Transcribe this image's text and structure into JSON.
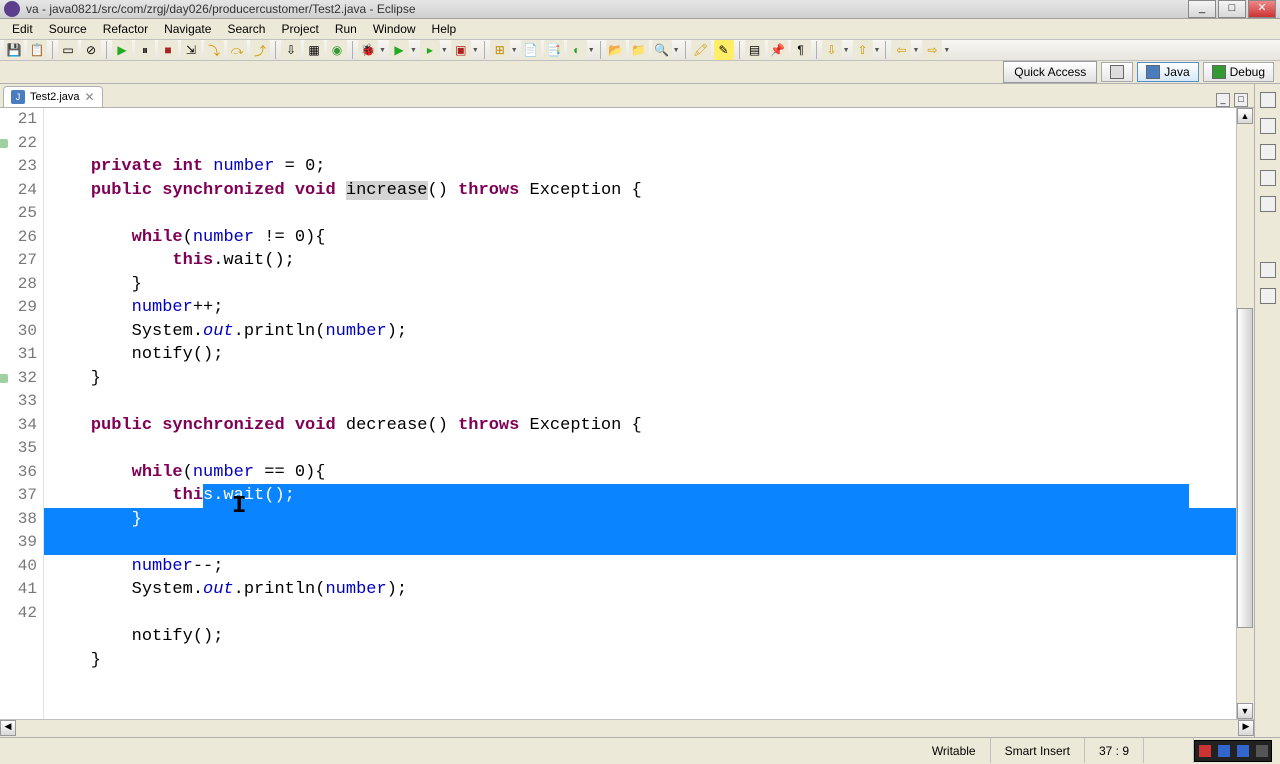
{
  "title": "va - java0821/src/com/zrgj/day026/producercustomer/Test2.java - Eclipse",
  "menu": {
    "items": [
      "Edit",
      "Source",
      "Refactor",
      "Navigate",
      "Search",
      "Project",
      "Run",
      "Window",
      "Help"
    ]
  },
  "quickaccess": "Quick Access",
  "perspectives": {
    "java": "Java",
    "debug": "Debug"
  },
  "tab": {
    "name": "Test2.java"
  },
  "code": {
    "lines": [
      {
        "n": 21,
        "seg": [
          {
            "t": "    ",
            "c": "pl"
          },
          {
            "t": "private",
            "c": "kw"
          },
          {
            "t": " ",
            "c": "pl"
          },
          {
            "t": "int",
            "c": "kw"
          },
          {
            "t": " ",
            "c": "pl"
          },
          {
            "t": "number",
            "c": "fld"
          },
          {
            "t": " = 0;",
            "c": "pl"
          }
        ]
      },
      {
        "n": 22,
        "seg": [
          {
            "t": "    ",
            "c": "pl"
          },
          {
            "t": "public",
            "c": "kw"
          },
          {
            "t": " ",
            "c": "pl"
          },
          {
            "t": "synchronized",
            "c": "kw"
          },
          {
            "t": " ",
            "c": "pl"
          },
          {
            "t": "void",
            "c": "kw"
          },
          {
            "t": " ",
            "c": "pl"
          },
          {
            "t": "increase",
            "c": "pl hl"
          },
          {
            "t": "() ",
            "c": "pl"
          },
          {
            "t": "throws",
            "c": "kw"
          },
          {
            "t": " Exception {",
            "c": "pl"
          }
        ],
        "mark": true
      },
      {
        "n": 23,
        "seg": [
          {
            "t": "",
            "c": "pl"
          }
        ]
      },
      {
        "n": 24,
        "seg": [
          {
            "t": "        ",
            "c": "pl"
          },
          {
            "t": "while",
            "c": "kw"
          },
          {
            "t": "(",
            "c": "pl"
          },
          {
            "t": "number",
            "c": "fld"
          },
          {
            "t": " != 0){",
            "c": "pl"
          }
        ]
      },
      {
        "n": 25,
        "seg": [
          {
            "t": "            ",
            "c": "pl"
          },
          {
            "t": "this",
            "c": "kw"
          },
          {
            "t": ".wait();",
            "c": "pl"
          }
        ]
      },
      {
        "n": 26,
        "seg": [
          {
            "t": "        }",
            "c": "pl"
          }
        ]
      },
      {
        "n": 27,
        "seg": [
          {
            "t": "        ",
            "c": "pl"
          },
          {
            "t": "number",
            "c": "fld"
          },
          {
            "t": "++;",
            "c": "pl"
          }
        ]
      },
      {
        "n": 28,
        "seg": [
          {
            "t": "        System.",
            "c": "pl"
          },
          {
            "t": "out",
            "c": "fld it"
          },
          {
            "t": ".println(",
            "c": "pl"
          },
          {
            "t": "number",
            "c": "fld"
          },
          {
            "t": ");",
            "c": "pl"
          }
        ]
      },
      {
        "n": 29,
        "seg": [
          {
            "t": "        notify();",
            "c": "pl"
          }
        ]
      },
      {
        "n": 30,
        "seg": [
          {
            "t": "    }",
            "c": "pl"
          }
        ]
      },
      {
        "n": 31,
        "seg": [
          {
            "t": "",
            "c": "pl"
          }
        ]
      },
      {
        "n": 32,
        "seg": [
          {
            "t": "    ",
            "c": "pl"
          },
          {
            "t": "public",
            "c": "kw"
          },
          {
            "t": " ",
            "c": "pl"
          },
          {
            "t": "synchronized",
            "c": "kw"
          },
          {
            "t": " ",
            "c": "pl"
          },
          {
            "t": "void",
            "c": "kw"
          },
          {
            "t": " decrease() ",
            "c": "pl"
          },
          {
            "t": "throws",
            "c": "kw"
          },
          {
            "t": " Exception {",
            "c": "pl"
          }
        ],
        "mark": true
      },
      {
        "n": 33,
        "seg": [
          {
            "t": "",
            "c": "pl"
          }
        ]
      },
      {
        "n": 34,
        "seg": [
          {
            "t": "        ",
            "c": "pl"
          },
          {
            "t": "while",
            "c": "kw"
          },
          {
            "t": "(",
            "c": "pl"
          },
          {
            "t": "number",
            "c": "fld"
          },
          {
            "t": " == 0){",
            "c": "pl"
          }
        ]
      },
      {
        "n": 35,
        "seg": [
          {
            "t": "            ",
            "c": "pl"
          },
          {
            "t": "thi",
            "c": "kw"
          }
        ],
        "selrest": "s.wait();"
      },
      {
        "n": 36,
        "seg": [],
        "selfull": "        }"
      },
      {
        "n": 37,
        "seg": [],
        "selfull": "        "
      },
      {
        "n": 38,
        "seg": [
          {
            "t": "        ",
            "c": "pl"
          },
          {
            "t": "number",
            "c": "fld"
          },
          {
            "t": "--;",
            "c": "pl"
          }
        ]
      },
      {
        "n": 39,
        "seg": [
          {
            "t": "        System.",
            "c": "pl"
          },
          {
            "t": "out",
            "c": "fld it"
          },
          {
            "t": ".println(",
            "c": "pl"
          },
          {
            "t": "number",
            "c": "fld"
          },
          {
            "t": ");",
            "c": "pl"
          }
        ]
      },
      {
        "n": 40,
        "seg": [
          {
            "t": "",
            "c": "pl"
          }
        ]
      },
      {
        "n": 41,
        "seg": [
          {
            "t": "        notify();",
            "c": "pl"
          }
        ]
      },
      {
        "n": 42,
        "seg": [
          {
            "t": "    }",
            "c": "pl"
          }
        ]
      }
    ]
  },
  "status": {
    "writable": "Writable",
    "mode": "Smart Insert",
    "pos": "37 : 9"
  }
}
